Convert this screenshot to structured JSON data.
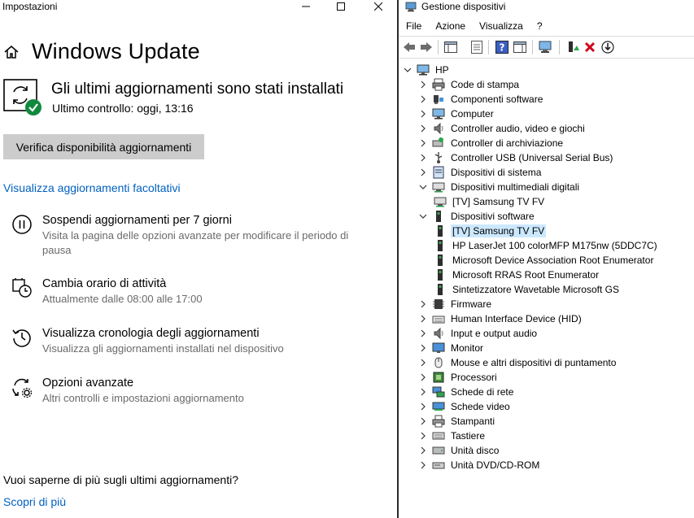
{
  "settings": {
    "window_title": "Impostazioni",
    "page_title": "Windows Update",
    "status_title": "Gli ultimi aggiornamenti sono stati installati",
    "status_sub": "Ultimo controllo: oggi, 13:16",
    "check_button": "Verifica disponibilità aggiornamenti",
    "optional_link": "Visualizza aggiornamenti facoltativi",
    "options": [
      {
        "title": "Sospendi aggiornamenti per 7 giorni",
        "desc": "Visita la pagina delle opzioni avanzate per modificare il periodo di pausa",
        "icon": "pause-icon"
      },
      {
        "title": "Cambia orario di attività",
        "desc": "Attualmente dalle 08:00 alle 17:00",
        "icon": "active-hours-icon"
      },
      {
        "title": "Visualizza cronologia degli aggiornamenti",
        "desc": "Visualizza gli aggiornamenti installati nel dispositivo",
        "icon": "history-icon"
      },
      {
        "title": "Opzioni avanzate",
        "desc": "Altri controlli e impostazioni aggiornamento",
        "icon": "advanced-options-icon"
      }
    ],
    "more_info_text": "Vuoi saperne di più sugli ultimi aggiornamenti?",
    "more_info_link": "Scopri di più"
  },
  "device_manager": {
    "title": "Gestione dispositivi",
    "menus": [
      "File",
      "Azione",
      "Visualizza",
      "?"
    ],
    "toolbar_icons": [
      "back-icon",
      "forward-icon",
      "properties-pane-icon",
      "list-icon",
      "help-icon",
      "console-icon",
      "scan-hardware-icon",
      "update-driver-icon",
      "uninstall-icon",
      "download-icon"
    ],
    "root": "HP",
    "tree": [
      {
        "label": "Code di stampa",
        "level": 1,
        "expanded": false,
        "icon": "print-queue-icon"
      },
      {
        "label": "Componenti software",
        "level": 1,
        "expanded": false,
        "icon": "software-component-icon"
      },
      {
        "label": "Computer",
        "level": 1,
        "expanded": false,
        "icon": "computer-icon"
      },
      {
        "label": "Controller audio, video e giochi",
        "level": 1,
        "expanded": false,
        "icon": "speaker-icon"
      },
      {
        "label": "Controller di archiviazione",
        "level": 1,
        "expanded": false,
        "icon": "storage-controller-icon"
      },
      {
        "label": "Controller USB (Universal Serial Bus)",
        "level": 1,
        "expanded": false,
        "icon": "usb-icon"
      },
      {
        "label": "Dispositivi di sistema",
        "level": 1,
        "expanded": false,
        "icon": "system-device-icon"
      },
      {
        "label": "Dispositivi multimediali digitali",
        "level": 1,
        "expanded": true,
        "icon": "media-device-icon"
      },
      {
        "label": "[TV] Samsung TV FV",
        "level": 2,
        "icon": "media-device-icon"
      },
      {
        "label": "Dispositivi software",
        "level": 1,
        "expanded": true,
        "icon": "software-device-icon"
      },
      {
        "label": "[TV] Samsung TV FV",
        "level": 2,
        "selected": true,
        "icon": "software-device-icon"
      },
      {
        "label": "HP LaserJet 100 colorMFP M175nw (5DDC7C)",
        "level": 2,
        "icon": "software-device-icon"
      },
      {
        "label": "Microsoft Device Association Root Enumerator",
        "level": 2,
        "icon": "software-device-icon"
      },
      {
        "label": "Microsoft RRAS Root Enumerator",
        "level": 2,
        "icon": "software-device-icon"
      },
      {
        "label": "Sintetizzatore Wavetable Microsoft GS",
        "level": 2,
        "icon": "software-device-icon"
      },
      {
        "label": "Firmware",
        "level": 1,
        "expanded": false,
        "icon": "firmware-icon"
      },
      {
        "label": "Human Interface Device (HID)",
        "level": 1,
        "expanded": false,
        "icon": "hid-icon"
      },
      {
        "label": "Input e output audio",
        "level": 1,
        "expanded": false,
        "icon": "speaker-icon"
      },
      {
        "label": "Monitor",
        "level": 1,
        "expanded": false,
        "icon": "monitor-icon"
      },
      {
        "label": "Mouse e altri dispositivi di puntamento",
        "level": 1,
        "expanded": false,
        "icon": "mouse-icon"
      },
      {
        "label": "Processori",
        "level": 1,
        "expanded": false,
        "icon": "processor-icon"
      },
      {
        "label": "Schede di rete",
        "level": 1,
        "expanded": false,
        "icon": "network-adapter-icon"
      },
      {
        "label": "Schede video",
        "level": 1,
        "expanded": false,
        "icon": "display-adapter-icon"
      },
      {
        "label": "Stampanti",
        "level": 1,
        "expanded": false,
        "icon": "printer-icon"
      },
      {
        "label": "Tastiere",
        "level": 1,
        "expanded": false,
        "icon": "keyboard-icon"
      },
      {
        "label": "Unità disco",
        "level": 1,
        "expanded": false,
        "icon": "disk-drive-icon"
      },
      {
        "label": "Unità DVD/CD-ROM",
        "level": 1,
        "expanded": false,
        "icon": "dvd-drive-icon"
      }
    ]
  },
  "colors": {
    "link": "#0060c0",
    "success": "#10893e",
    "selection": "#cce8ff",
    "button_bg": "#cccccc"
  }
}
